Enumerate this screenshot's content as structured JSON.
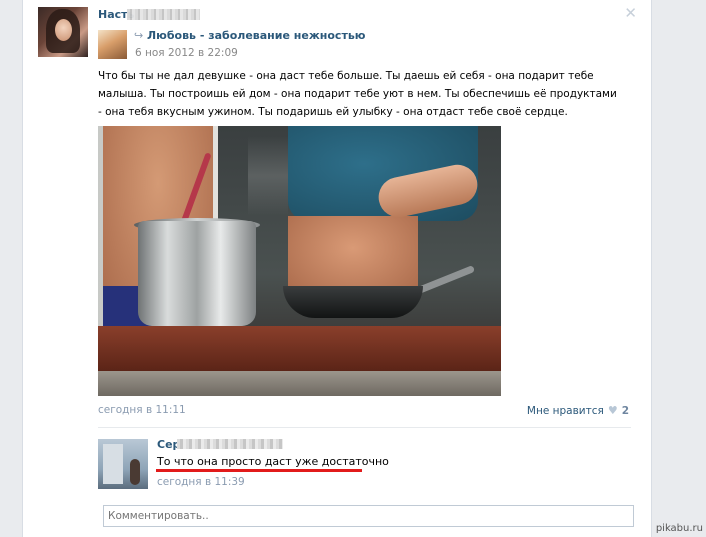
{
  "post": {
    "author_name": "Насть",
    "group_name": "Любовь - заболевание нежностью",
    "repost_date": "6 ноя 2012 в 22:09",
    "text": "Что бы ты не дал девушке - она даст тебе больше. Ты даешь ей себя - она подарит тебе малыша. Ты построишь ей дом - она подарит тебе уют в нем. Ты обеспечишь её продуктами - она тебя вкусным ужином. Ты подаришь ей улыбку - она отдаст тебе своё сердце.",
    "time": "сегодня в 11:11",
    "like_label": "Мне нравится",
    "like_count": "2"
  },
  "comment": {
    "author_name": "Серг",
    "text": "То что она просто даст уже достаточно",
    "time": "сегодня в 11:39"
  },
  "comment_input": {
    "placeholder": "Комментировать.."
  },
  "icons": {
    "close": "close-icon",
    "repost": "repost-icon",
    "heart": "heart-icon"
  },
  "watermark": "pikabu.ru",
  "colors": {
    "link": "#2b587a",
    "muted": "#8a9bb0",
    "underline": "#e21b1b"
  }
}
